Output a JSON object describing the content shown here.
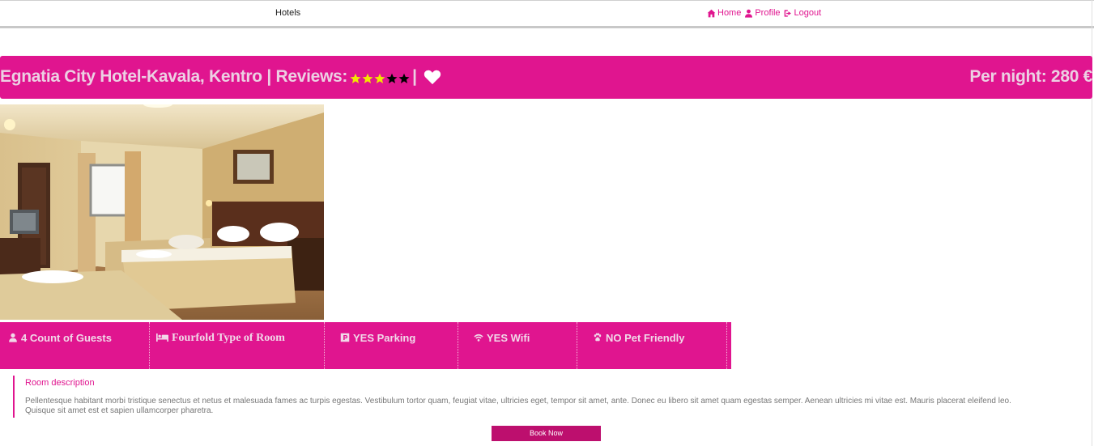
{
  "nav": {
    "brand": "Hotels",
    "links": [
      {
        "label": "Home",
        "icon": "home-icon"
      },
      {
        "label": "Profile",
        "icon": "user-icon"
      },
      {
        "label": "Logout",
        "icon": "logout-icon"
      }
    ]
  },
  "hotel": {
    "title": "Egnatia City Hotel-Kavala, Kentro | Reviews:",
    "rating": 3,
    "rating_max": 5,
    "separator": "|",
    "price": "Per night: 280 €"
  },
  "features": [
    {
      "icon": "user-icon",
      "label": "4 Count of Guests"
    },
    {
      "icon": "bed-icon",
      "label": "Fourfold Type of Room"
    },
    {
      "icon": "parking-icon",
      "label": "YES Parking"
    },
    {
      "icon": "wifi-icon",
      "label": "YES Wifi"
    },
    {
      "icon": "paw-icon",
      "label": "NO Pet Friendly"
    }
  ],
  "room": {
    "heading": "Room description",
    "text": "Pellentesque habitant morbi tristique senectus et netus et malesuada fames ac turpis egestas. Vestibulum tortor quam, feugiat vitae, ultricies eget, tempor sit amet, ante. Donec eu libero sit amet quam egestas semper. Aenean ultricies mi vitae est. Mauris placerat eleifend leo. Quisque sit amet est et sapien ullamcorper pharetra."
  },
  "book_label": "Book Now",
  "colors": {
    "accent": "#e0158f",
    "button": "#bd0f6e",
    "star_on": "#f2e600",
    "star_off": "#000000"
  }
}
